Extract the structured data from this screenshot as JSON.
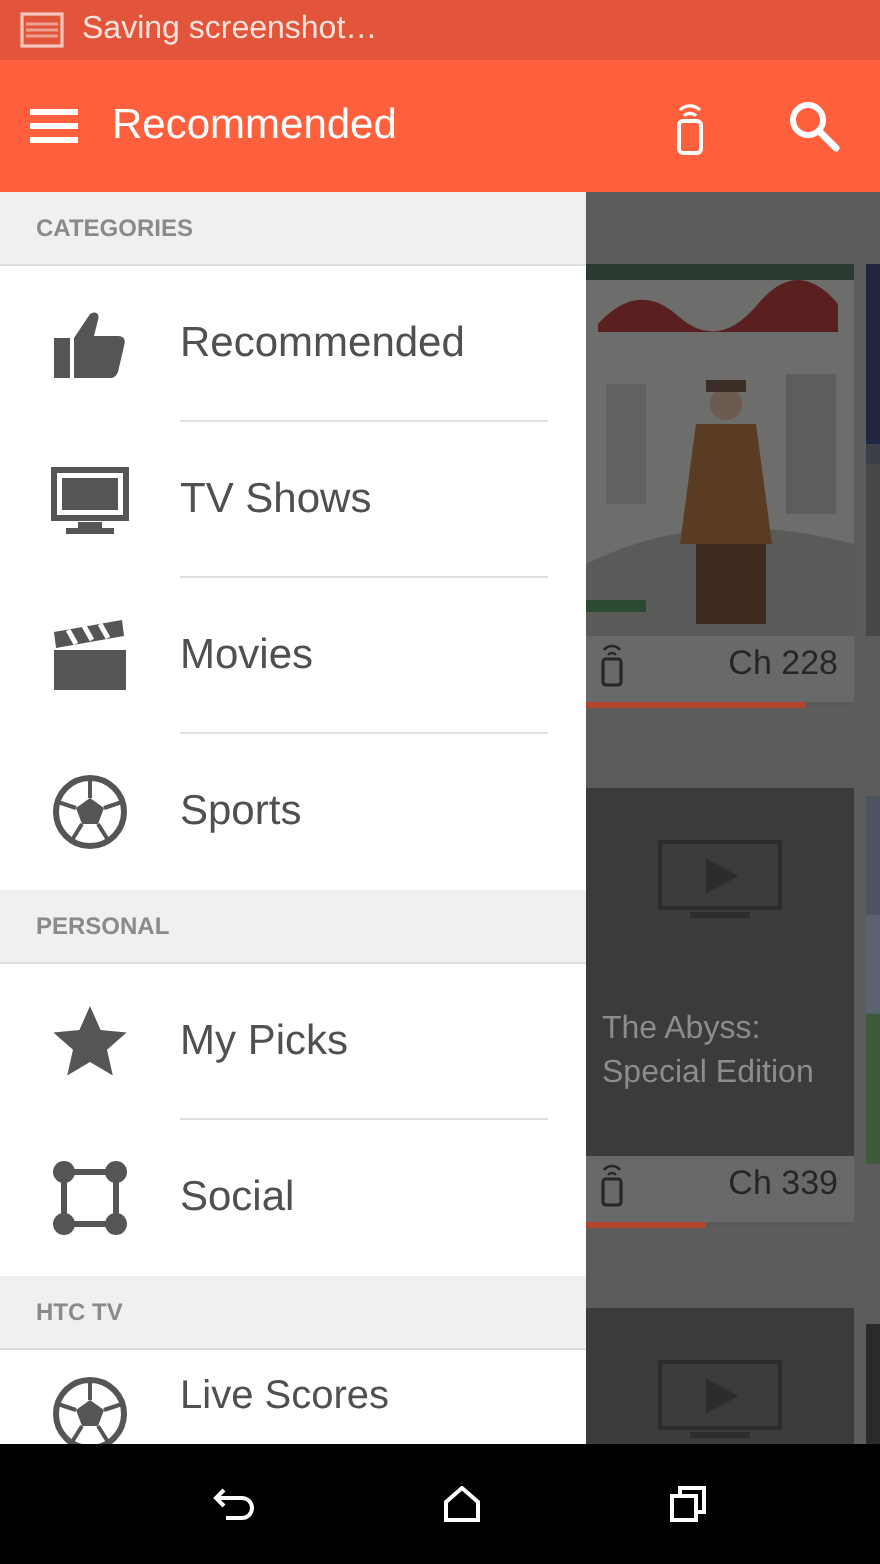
{
  "status_bar": {
    "notification": "Saving screenshot…"
  },
  "app_bar": {
    "title": "Recommended"
  },
  "drawer": {
    "sections": [
      {
        "header": "CATEGORIES",
        "items": [
          {
            "label": "Recommended"
          },
          {
            "label": "TV Shows"
          },
          {
            "label": "Movies"
          },
          {
            "label": "Sports"
          }
        ]
      },
      {
        "header": "PERSONAL",
        "items": [
          {
            "label": "My Picks"
          },
          {
            "label": "Social"
          }
        ]
      },
      {
        "header": "HTC TV",
        "items": [
          {
            "label": "Live Scores"
          }
        ]
      }
    ]
  },
  "cards": [
    {
      "kind": "poster",
      "channel": "Ch 228",
      "level": 0.82
    },
    {
      "kind": "placeholder",
      "title": "The Abyss: Special Edition",
      "channel": "Ch 339",
      "level": 0.45
    },
    {
      "kind": "placeholder"
    }
  ]
}
